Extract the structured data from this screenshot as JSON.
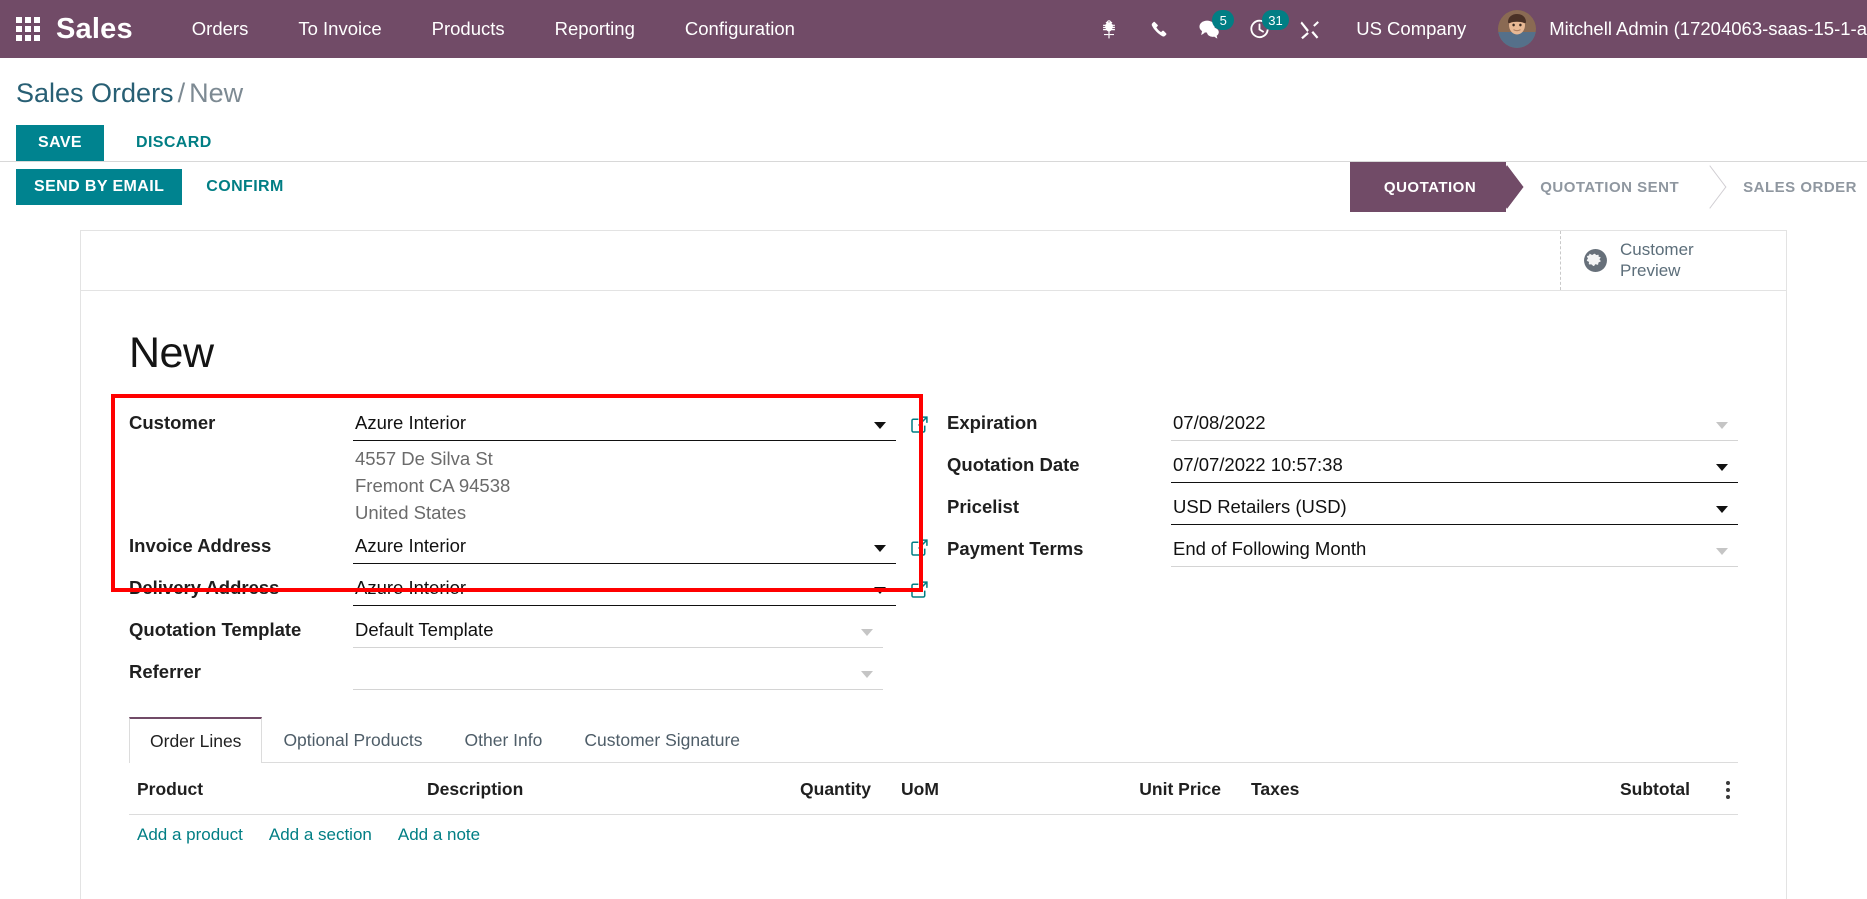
{
  "navbar": {
    "brand": "Sales",
    "menu": [
      {
        "label": "Orders"
      },
      {
        "label": "To Invoice"
      },
      {
        "label": "Products"
      },
      {
        "label": "Reporting"
      },
      {
        "label": "Configuration"
      }
    ],
    "icons": {
      "apps": "apps-grid-icon",
      "bug": "bug-icon",
      "phone": "phone-icon",
      "messages": "chat-icon",
      "activities": "clock-icon",
      "tools": "tools-icon"
    },
    "messages_count": "5",
    "activities_count": "31",
    "company": "US Company",
    "user": "Mitchell Admin (17204063-saas-15-1-a"
  },
  "breadcrumb": {
    "root": "Sales Orders",
    "separator": "/",
    "current": "New"
  },
  "edit_buttons": {
    "save": "SAVE",
    "discard": "DISCARD"
  },
  "actions": {
    "send_by_email": "SEND BY EMAIL",
    "confirm": "CONFIRM"
  },
  "statusbar": {
    "steps": [
      {
        "label": "QUOTATION",
        "active": true
      },
      {
        "label": "QUOTATION SENT",
        "active": false
      },
      {
        "label": "SALES ORDER",
        "active": false
      }
    ]
  },
  "sheet": {
    "customer_preview": "Customer Preview",
    "title": "New"
  },
  "form": {
    "left": [
      {
        "label": "Customer",
        "value": "Azure Interior",
        "placeholder": "",
        "dropdown": "strong",
        "external": true
      },
      {
        "label": "Invoice Address",
        "value": "Azure Interior",
        "placeholder": "",
        "dropdown": "strong",
        "external": true
      },
      {
        "label": "Delivery Address",
        "value": "Azure Interior",
        "placeholder": "",
        "dropdown": "strong",
        "external": true
      },
      {
        "label": "Quotation Template",
        "value": "Default Template",
        "placeholder": "",
        "dropdown": "faint",
        "external": false
      },
      {
        "label": "Referrer",
        "value": "",
        "placeholder": "",
        "dropdown": "faint",
        "external": false
      }
    ],
    "address_lines": [
      "4557 De Silva St",
      "Fremont CA 94538",
      "United States"
    ],
    "right": [
      {
        "label": "Expiration",
        "value": "07/08/2022",
        "dropdown": "faint"
      },
      {
        "label": "Quotation Date",
        "value": "07/07/2022 10:57:38",
        "dropdown": "strong"
      },
      {
        "label": "Pricelist",
        "value": "USD Retailers (USD)",
        "dropdown": "strong"
      },
      {
        "label": "Payment Terms",
        "value": "End of Following Month",
        "dropdown": "faint"
      }
    ]
  },
  "notebook": {
    "tabs": [
      {
        "label": "Order Lines",
        "active": true
      },
      {
        "label": "Optional Products",
        "active": false
      },
      {
        "label": "Other Info",
        "active": false
      },
      {
        "label": "Customer Signature",
        "active": false
      }
    ],
    "columns": {
      "product": "Product",
      "description": "Description",
      "quantity": "Quantity",
      "uom": "UoM",
      "unit_price": "Unit Price",
      "taxes": "Taxes",
      "subtotal": "Subtotal"
    },
    "add_links": [
      {
        "label": "Add a product"
      },
      {
        "label": "Add a section"
      },
      {
        "label": "Add a note"
      }
    ]
  },
  "colors": {
    "brand_purple": "#714B67",
    "accent_teal": "#017e84",
    "highlight_red": "#ff0000"
  }
}
